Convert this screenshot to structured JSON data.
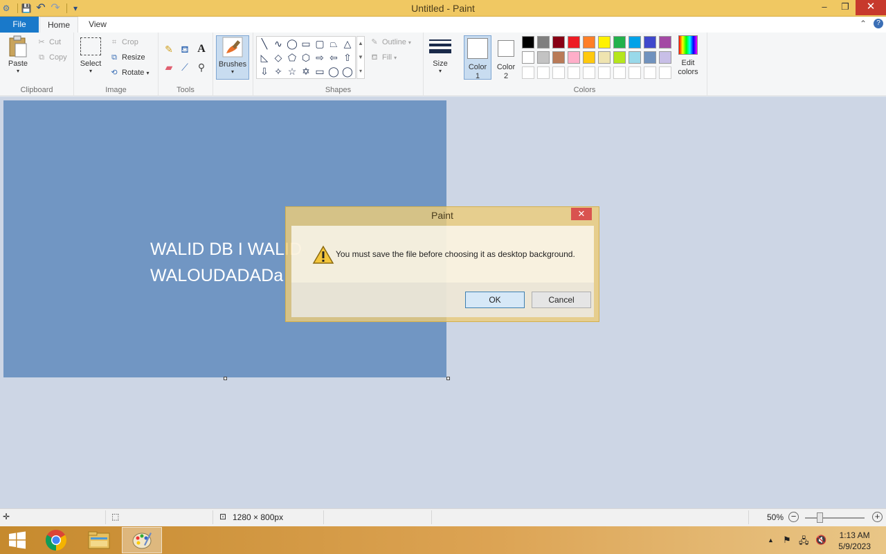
{
  "window": {
    "title": "Untitled - Paint",
    "minimize": "–",
    "restore": "❐",
    "close": "✕"
  },
  "qat": {
    "paint_icon": "⚙",
    "save": "💾",
    "undo": "↶",
    "redo": "↷",
    "customize": "▾"
  },
  "tabs": {
    "file": "File",
    "home": "Home",
    "view": "View",
    "collapse": "⌃",
    "help": "?"
  },
  "clipboard": {
    "paste": "Paste",
    "cut": "Cut",
    "copy": "Copy",
    "label": "Clipboard"
  },
  "image": {
    "select": "Select",
    "crop": "Crop",
    "resize": "Resize",
    "rotate": "Rotate",
    "label": "Image"
  },
  "tools": {
    "label": "Tools",
    "text_glyph": "A"
  },
  "brushes": {
    "label": "Brushes"
  },
  "shapes": {
    "outline": "Outline",
    "fill": "Fill",
    "label": "Shapes",
    "glyphs": [
      "╲",
      "∿",
      "◯",
      "▭",
      "▢",
      "⏢",
      "△",
      "◺",
      "◇",
      "⬠",
      "⬡",
      "⇨",
      "⇦",
      "⇧",
      "⇩",
      "✧",
      "☆",
      "✡",
      "▭",
      "◯",
      "◯"
    ]
  },
  "size": {
    "label": "Size"
  },
  "colors": {
    "color1_line1": "Color",
    "color1_line2": "1",
    "color2_line1": "Color",
    "color2_line2": "2",
    "edit_line1": "Edit",
    "edit_line2": "colors",
    "label": "Colors",
    "palette_row1": [
      "#000000",
      "#7f7f7f",
      "#880015",
      "#ed1c24",
      "#ff7f27",
      "#fff200",
      "#22b14c",
      "#00a2e8",
      "#3f48cc",
      "#a349a4"
    ],
    "palette_row2": [
      "#ffffff",
      "#c3c3c3",
      "#b97a57",
      "#ffaec9",
      "#ffc90e",
      "#efe4b0",
      "#b5e61d",
      "#99d9ea",
      "#7092be",
      "#c8bfe7"
    ]
  },
  "canvas": {
    "text_line1": "WALID DB I WALID",
    "text_line2": "WALOUDADADa",
    "color": "#7196c3"
  },
  "dialog": {
    "title": "Paint",
    "close": "✕",
    "message": "You must save the file before choosing it as desktop background.",
    "ok": "OK",
    "cancel": "Cancel"
  },
  "status": {
    "move_icon": "✛",
    "select_icon": "⬚",
    "size_icon": "⊡",
    "dimensions": "1280 × 800px",
    "zoom": "50%",
    "zoom_out": "−",
    "zoom_in": "+"
  },
  "taskbar": {
    "tray_up": "▲",
    "flag": "⚑",
    "network": "🖧",
    "volume": "🔇",
    "time": "1:13 AM",
    "date": "5/9/2023"
  }
}
